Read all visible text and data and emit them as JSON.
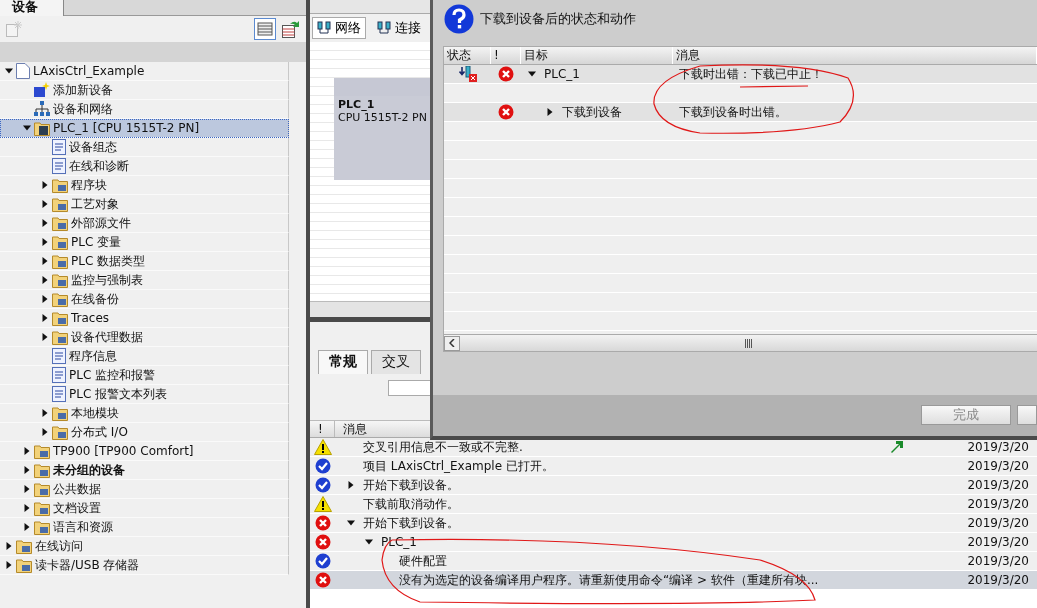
{
  "project_tree": {
    "tab": {
      "label": "设备",
      "selected": true
    },
    "items": [
      {
        "label": "LAxisCtrl_Example",
        "kind": "project",
        "expanded": true,
        "selected": false,
        "children": [
          {
            "label": "添加新设备",
            "kind": "add",
            "selected": false
          },
          {
            "label": "设备和网络",
            "kind": "network",
            "selected": false
          },
          {
            "label": "PLC_1 [CPU 1515T-2 PN]",
            "kind": "device",
            "expanded": true,
            "selected": true,
            "children": [
              {
                "label": "设备组态",
                "kind": "item",
                "selected": false
              },
              {
                "label": "在线和诊断",
                "kind": "item",
                "selected": false
              },
              {
                "label": "程序块",
                "kind": "folder",
                "expanded": false,
                "selected": false
              },
              {
                "label": "工艺对象",
                "kind": "folder",
                "expanded": false,
                "selected": false
              },
              {
                "label": "外部源文件",
                "kind": "folder",
                "expanded": false,
                "selected": false
              },
              {
                "label": "PLC 变量",
                "kind": "folder",
                "expanded": false,
                "selected": false
              },
              {
                "label": "PLC 数据类型",
                "kind": "folder",
                "expanded": false,
                "selected": false
              },
              {
                "label": "监控与强制表",
                "kind": "folder",
                "expanded": false,
                "selected": false
              },
              {
                "label": "在线备份",
                "kind": "folder",
                "expanded": false,
                "selected": false
              },
              {
                "label": "Traces",
                "kind": "folder",
                "expanded": false,
                "selected": false
              },
              {
                "label": "设备代理数据",
                "kind": "folder",
                "expanded": false,
                "selected": false
              },
              {
                "label": "程序信息",
                "kind": "item",
                "selected": false
              },
              {
                "label": "PLC 监控和报警",
                "kind": "item",
                "selected": false
              },
              {
                "label": "PLC 报警文本列表",
                "kind": "item",
                "selected": false
              },
              {
                "label": "本地模块",
                "kind": "folder",
                "expanded": false,
                "selected": false
              },
              {
                "label": "分布式 I/O",
                "kind": "folder",
                "expanded": false,
                "selected": false
              }
            ]
          },
          {
            "label": "TP900 [TP900 Comfort]",
            "kind": "folder",
            "expanded": false,
            "selected": false
          },
          {
            "label": "未分组的设备",
            "kind": "group",
            "expanded": false,
            "selected": false
          },
          {
            "label": "公共数据",
            "kind": "folder",
            "expanded": false,
            "selected": false
          },
          {
            "label": "文档设置",
            "kind": "folder",
            "expanded": false,
            "selected": false
          },
          {
            "label": "语言和资源",
            "kind": "folder",
            "expanded": false,
            "selected": false
          }
        ]
      },
      {
        "label": "在线访问",
        "kind": "folder",
        "expanded": false,
        "selected": false
      },
      {
        "label": "读卡器/USB 存储器",
        "kind": "folder",
        "expanded": false,
        "selected": false
      }
    ]
  },
  "network_view": {
    "toolbar": [
      {
        "label": "网络",
        "selected": true
      },
      {
        "label": "连接",
        "selected": false
      }
    ],
    "device": {
      "name": "PLC_1",
      "type": "CPU 1515T-2 PN"
    }
  },
  "inspector": {
    "tabs": [
      {
        "label": "常规",
        "selected": true
      },
      {
        "label": "交叉",
        "selected": false
      }
    ],
    "columns": [
      "!",
      "消息"
    ],
    "messages": [
      {
        "kind": "warning",
        "text": "交叉引用信息不一致或不完整.",
        "goto": true,
        "date": "2019/3/20",
        "selected": false
      },
      {
        "kind": "ok",
        "text": "项目 LAxisCtrl_Example 已打开。",
        "goto": false,
        "date": "2019/3/20",
        "selected": false
      },
      {
        "kind": "ok",
        "text": "开始下载到设备。",
        "expanded": false,
        "goto": false,
        "date": "2019/3/20",
        "selected": false
      },
      {
        "kind": "warning",
        "text": "下载前取消动作。",
        "goto": false,
        "date": "2019/3/20",
        "selected": false
      },
      {
        "kind": "error",
        "text": "开始下载到设备。",
        "expanded": true,
        "goto": false,
        "date": "2019/3/20",
        "selected": false,
        "children": [
          {
            "kind": "error",
            "text": "PLC_1",
            "expanded": true,
            "goto": false,
            "date": "2019/3/20",
            "selected": false,
            "children": [
              {
                "kind": "ok",
                "text": "硬件配置",
                "goto": false,
                "date": "2019/3/20",
                "selected": false
              },
              {
                "kind": "error",
                "text": "没有为选定的设备编译用户程序。请重新使用命令“编译 > 软件（重建所有块...",
                "goto": false,
                "date": "2019/3/20",
                "selected": true
              }
            ]
          }
        ]
      }
    ]
  },
  "dialog": {
    "title": "下载到设备后的状态和动作",
    "columns": [
      "状态",
      "!",
      "目标",
      "消息"
    ],
    "rows": [
      {
        "kind": "device_error",
        "target": "PLC_1",
        "expanded": true,
        "message": "下载时出错：下载已中止！",
        "children": [
          {
            "kind": "blank"
          },
          {
            "kind": "error",
            "target": "下载到设备",
            "expanded": false,
            "message": "下载到设备时出错。"
          }
        ]
      }
    ],
    "buttons": [
      {
        "label": "完成",
        "disabled": true
      }
    ]
  }
}
